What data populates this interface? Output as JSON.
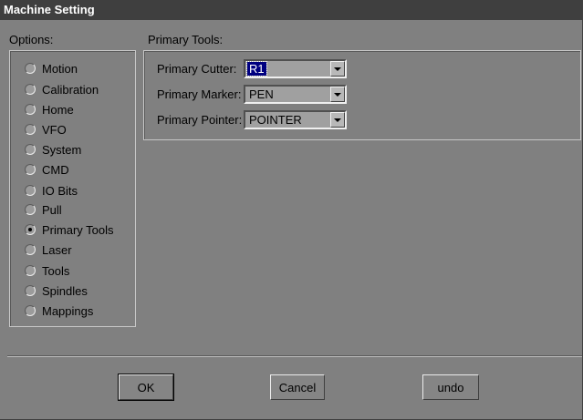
{
  "window": {
    "title": "Machine Setting"
  },
  "options": {
    "label": "Options:",
    "items": [
      {
        "label": "Motion",
        "checked": false
      },
      {
        "label": "Calibration",
        "checked": false
      },
      {
        "label": "Home",
        "checked": false
      },
      {
        "label": "VFO",
        "checked": false
      },
      {
        "label": "System",
        "checked": false
      },
      {
        "label": "CMD",
        "checked": false
      },
      {
        "label": "IO Bits",
        "checked": false
      },
      {
        "label": "Pull",
        "checked": false
      },
      {
        "label": "Primary Tools",
        "checked": true
      },
      {
        "label": "Laser",
        "checked": false
      },
      {
        "label": "Tools",
        "checked": false
      },
      {
        "label": "Spindles",
        "checked": false
      },
      {
        "label": "Mappings",
        "checked": false
      }
    ]
  },
  "primary_tools": {
    "label": "Primary Tools:",
    "fields": [
      {
        "label": "Primary Cutter:",
        "value": "R1",
        "focused": true
      },
      {
        "label": "Primary Marker:",
        "value": "PEN",
        "focused": false
      },
      {
        "label": "Primary Pointer:",
        "value": "POINTER",
        "focused": false
      }
    ]
  },
  "buttons": {
    "ok": "OK",
    "cancel": "Cancel",
    "undo": "undo"
  },
  "icons": {
    "combo_arrow": "chevron-down-icon",
    "radio": "radio-icon"
  }
}
